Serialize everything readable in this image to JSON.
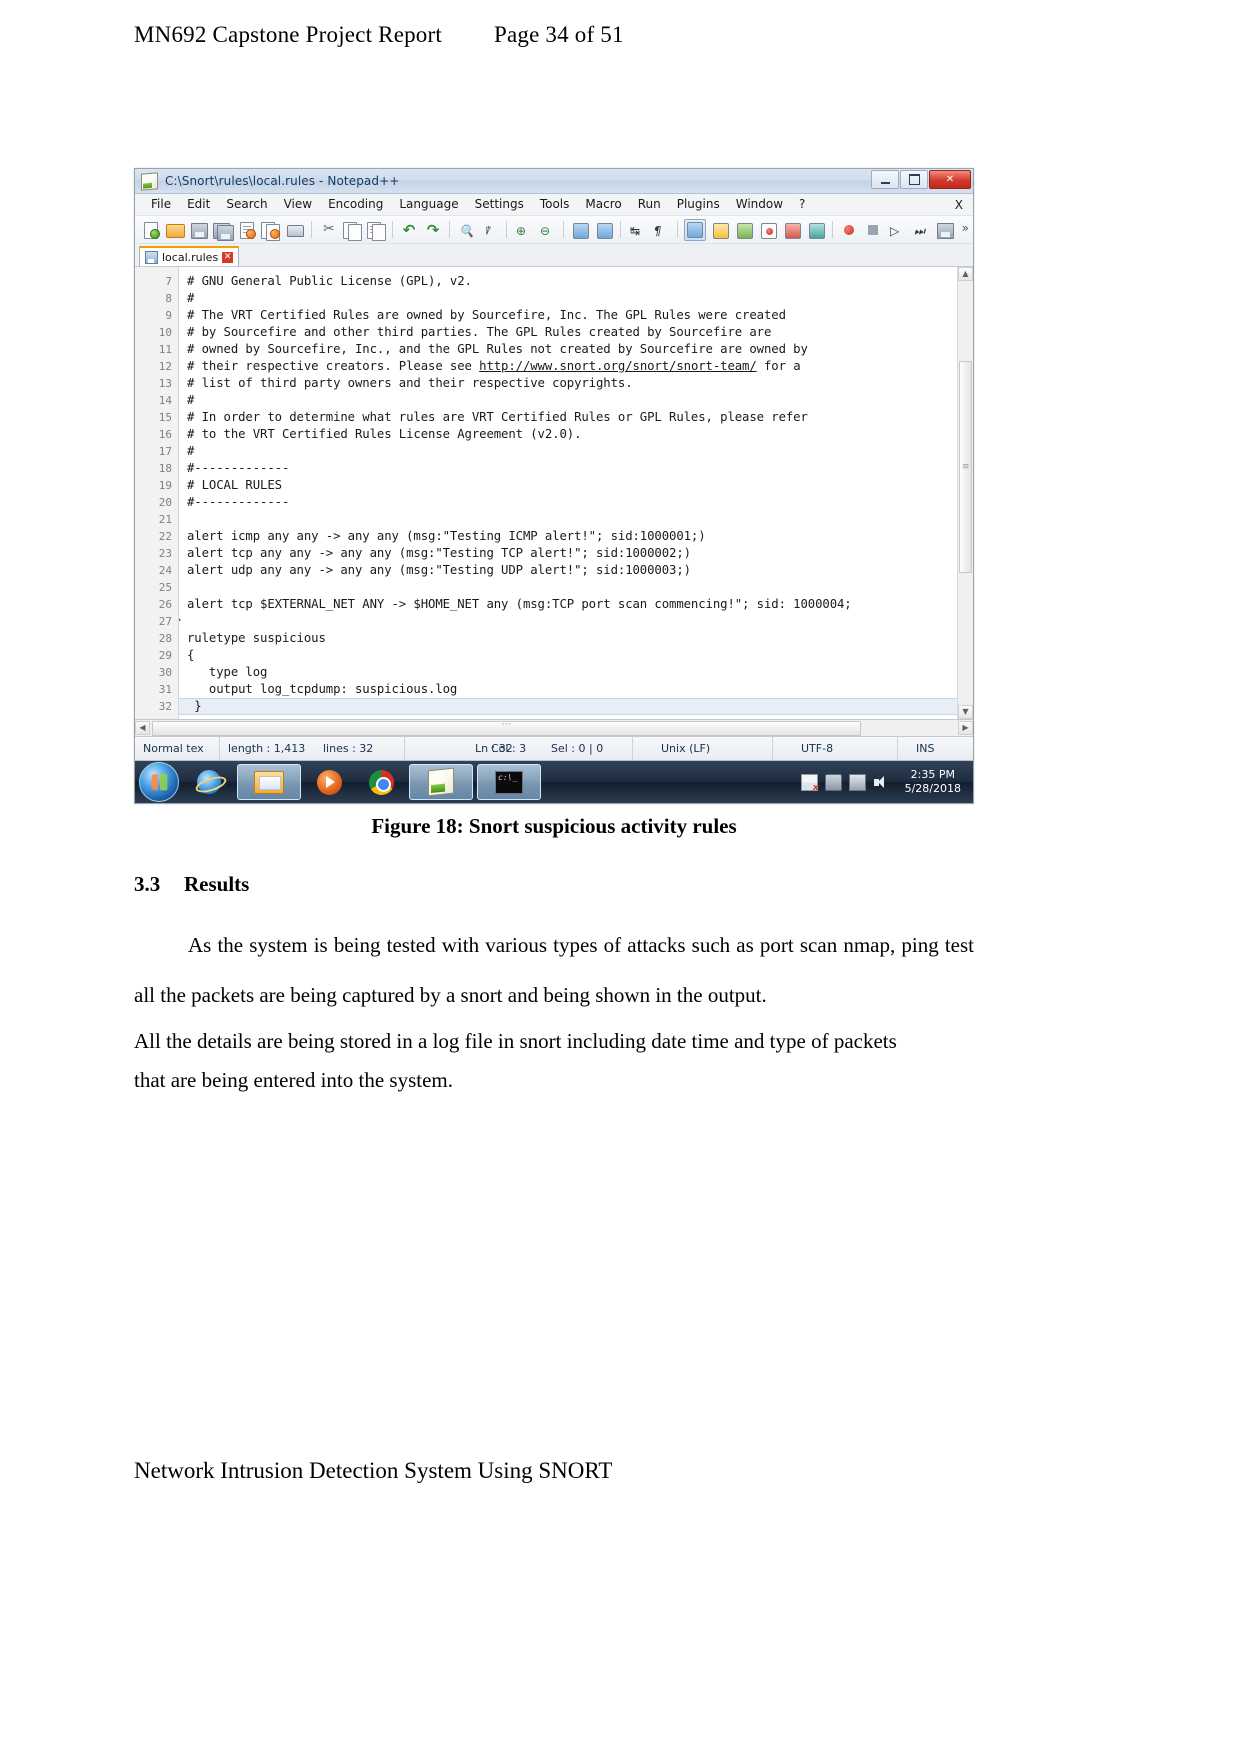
{
  "document": {
    "header_title": "MN692 Capstone Project Report",
    "header_page": "Page 34 of 51",
    "footer": "Network Intrusion Detection System Using SNORT",
    "figure_caption": "Figure 18: Snort suspicious activity rules",
    "section": {
      "number": "3.3",
      "title": "Results"
    },
    "paragraph_1": "As the system is being tested with various types of attacks such as port scan nmap, ping test all the packets are being captured by a snort and being shown in the output.",
    "paragraph_2_line1": "All the details are being stored in a log file in snort including date time and type of packets",
    "paragraph_2_line2": "that are being entered into the system."
  },
  "app": {
    "title": "C:\\Snort\\rules\\local.rules - Notepad++",
    "window_controls": {
      "minimize": "–",
      "maximize": "□",
      "close": "✕"
    },
    "menu": [
      "File",
      "Edit",
      "Search",
      "View",
      "Encoding",
      "Language",
      "Settings",
      "Tools",
      "Macro",
      "Run",
      "Plugins",
      "Window",
      "?"
    ],
    "menu_close_label": "X",
    "toolbar_overflow": "»",
    "tab": {
      "label": "local.rules",
      "close": "✕"
    }
  },
  "editor": {
    "first_line_number": 7,
    "current_line": 32,
    "lines": [
      {
        "n": 7,
        "text": "# GNU General Public License (GPL), v2."
      },
      {
        "n": 8,
        "text": "#"
      },
      {
        "n": 9,
        "text": "# The VRT Certified Rules are owned by Sourcefire, Inc. The GPL Rules were created"
      },
      {
        "n": 10,
        "text": "# by Sourcefire and other third parties. The GPL Rules created by Sourcefire are"
      },
      {
        "n": 11,
        "text": "# owned by Sourcefire, Inc., and the GPL Rules not created by Sourcefire are owned by"
      },
      {
        "n": 12,
        "text": "# their respective creators. Please see http://www.snort.org/snort/snort-team/ for a",
        "link": "http://www.snort.org/snort/snort-team/"
      },
      {
        "n": 13,
        "text": "# list of third party owners and their respective copyrights."
      },
      {
        "n": 14,
        "text": "#"
      },
      {
        "n": 15,
        "text": "# In order to determine what rules are VRT Certified Rules or GPL Rules, please refer"
      },
      {
        "n": 16,
        "text": "# to the VRT Certified Rules License Agreement (v2.0)."
      },
      {
        "n": 17,
        "text": "#"
      },
      {
        "n": 18,
        "text": "#-------------"
      },
      {
        "n": 19,
        "text": "# LOCAL RULES"
      },
      {
        "n": 20,
        "text": "#-------------"
      },
      {
        "n": 21,
        "text": ""
      },
      {
        "n": 22,
        "text": "alert icmp any any -> any any (msg:\"Testing ICMP alert!\"; sid:1000001;)"
      },
      {
        "n": 23,
        "text": "alert tcp any any -> any any (msg:\"Testing TCP alert!\"; sid:1000002;)"
      },
      {
        "n": 24,
        "text": "alert udp any any -> any any (msg:\"Testing UDP alert!\"; sid:1000003;)"
      },
      {
        "n": 25,
        "text": ""
      },
      {
        "n": 26,
        "text": "alert tcp $EXTERNAL_NET ANY -> $HOME_NET any (msg:TCP port scan commencing!\"; sid: 1000004;"
      },
      {
        "n": 27,
        "text": ""
      },
      {
        "n": 28,
        "text": "ruletype suspicious"
      },
      {
        "n": 29,
        "text": "{"
      },
      {
        "n": 30,
        "text": "   type log"
      },
      {
        "n": 31,
        "text": "   output log_tcpdump: suspicious.log"
      },
      {
        "n": 32,
        "text": " }"
      }
    ]
  },
  "status_bar": {
    "doc_type": "Normal tex",
    "length_label": "length : 1,413",
    "lines_label": "lines : 32",
    "ln": "Ln : 32",
    "col": "Col : 3",
    "sel": "Sel : 0 | 0",
    "eol": "Unix (LF)",
    "encoding": "UTF-8",
    "insert_mode": "INS"
  },
  "taskbar": {
    "start_label": "start-orb",
    "buttons": [
      {
        "name": "internet-explorer",
        "icon": "ie-icon",
        "active": false
      },
      {
        "name": "windows-explorer",
        "icon": "folder-icon",
        "active": true
      },
      {
        "name": "windows-media-player",
        "icon": "media-player-icon",
        "active": false
      },
      {
        "name": "google-chrome",
        "icon": "chrome-icon",
        "active": false
      },
      {
        "name": "notepad-plus-plus",
        "icon": "notepadpp-icon",
        "active": true
      },
      {
        "name": "command-prompt",
        "icon": "cmd-icon",
        "active": true
      }
    ],
    "tray": [
      "action-center-icon",
      "usb-icon",
      "network-icon",
      "volume-icon"
    ],
    "clock_time": "2:35 PM",
    "clock_date": "5/28/2018"
  },
  "colors": {
    "accent_orange": "#f0a000",
    "close_red": "#d23a2b",
    "title_blue": "#173b61",
    "gutter_grey": "#f2f2f2",
    "current_line": "#e8eef8"
  }
}
